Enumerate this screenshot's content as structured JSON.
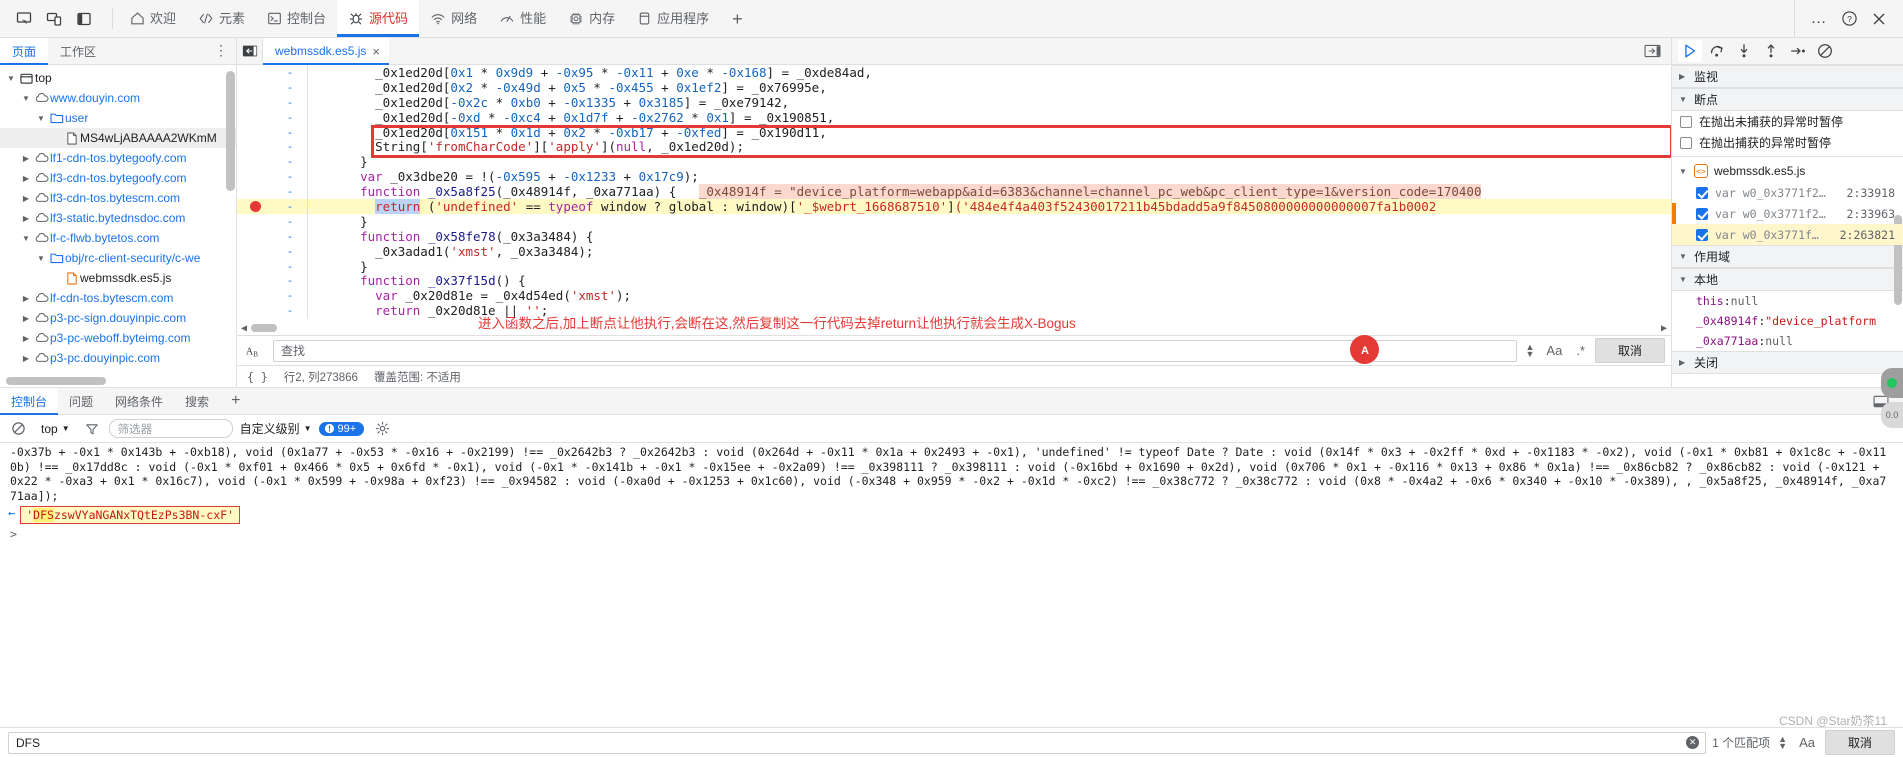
{
  "topbar": {
    "device_icons": [
      "inspect-icon",
      "device-toggle-icon",
      "dock-side-icon"
    ],
    "tabs": [
      {
        "label": "欢迎",
        "icon": "home-icon",
        "active": false
      },
      {
        "label": "元素",
        "icon": "code-brackets-icon",
        "active": false
      },
      {
        "label": "控制台",
        "icon": "terminal-icon",
        "active": false
      },
      {
        "label": "源代码",
        "icon": "bug-icon",
        "active": true
      },
      {
        "label": "网络",
        "icon": "wifi-icon",
        "active": false
      },
      {
        "label": "性能",
        "icon": "gauge-icon",
        "active": false
      },
      {
        "label": "内存",
        "icon": "chip-icon",
        "active": false
      },
      {
        "label": "应用程序",
        "icon": "database-icon",
        "active": false
      }
    ],
    "add_label": "+",
    "more_label": "…",
    "help_label": "?",
    "close_label": "×"
  },
  "navigator": {
    "tabs": [
      {
        "label": "页面",
        "active": true
      },
      {
        "label": "工作区",
        "active": false
      }
    ],
    "more_label": "⋮",
    "tree": [
      {
        "label": "top",
        "depth": 0,
        "icon": "frame-icon",
        "twisty": "down",
        "color": "dark"
      },
      {
        "label": "www.douyin.com",
        "depth": 1,
        "icon": "cloud-icon",
        "twisty": "down",
        "color": "link"
      },
      {
        "label": "user",
        "depth": 2,
        "icon": "folder-icon",
        "twisty": "down",
        "color": "link"
      },
      {
        "label": "MS4wLjABAAAA2WKmM",
        "depth": 3,
        "icon": "file-icon",
        "twisty": "none",
        "color": "dark",
        "selected": true
      },
      {
        "label": "lf1-cdn-tos.bytegoofy.com",
        "depth": 1,
        "icon": "cloud-icon",
        "twisty": "right",
        "color": "link"
      },
      {
        "label": "lf3-cdn-tos.bytegoofy.com",
        "depth": 1,
        "icon": "cloud-icon",
        "twisty": "right",
        "color": "link"
      },
      {
        "label": "lf3-cdn-tos.bytescm.com",
        "depth": 1,
        "icon": "cloud-icon",
        "twisty": "right",
        "color": "link"
      },
      {
        "label": "lf3-static.bytednsdoc.com",
        "depth": 1,
        "icon": "cloud-icon",
        "twisty": "right",
        "color": "link"
      },
      {
        "label": "lf-c-flwb.bytetos.com",
        "depth": 1,
        "icon": "cloud-icon",
        "twisty": "down",
        "color": "link"
      },
      {
        "label": "obj/rc-client-security/c-we",
        "depth": 2,
        "icon": "folder-icon",
        "twisty": "down",
        "color": "link"
      },
      {
        "label": "webmssdk.es5.js",
        "depth": 3,
        "icon": "js-file-icon",
        "twisty": "none",
        "color": "dark"
      },
      {
        "label": "lf-cdn-tos.bytescm.com",
        "depth": 1,
        "icon": "cloud-icon",
        "twisty": "right",
        "color": "link"
      },
      {
        "label": "p3-pc-sign.douyinpic.com",
        "depth": 1,
        "icon": "cloud-icon",
        "twisty": "right",
        "color": "link"
      },
      {
        "label": "p3-pc-weboff.byteimg.com",
        "depth": 1,
        "icon": "cloud-icon",
        "twisty": "right",
        "color": "link"
      },
      {
        "label": "p3-pc.douyinpic.com",
        "depth": 1,
        "icon": "cloud-icon",
        "twisty": "right",
        "color": "link"
      }
    ]
  },
  "editor": {
    "tab_label": "webmssdk.es5.js",
    "tab_close": "×",
    "lines": [
      {
        "num": "-",
        "indent": 6,
        "segments": [
          {
            "t": "_0x1ed20d",
            "c": "plain"
          },
          {
            "t": "[",
            "c": "op"
          },
          {
            "t": "0x1",
            "c": "num"
          },
          {
            "t": " * ",
            "c": "op"
          },
          {
            "t": "0x9d9",
            "c": "num"
          },
          {
            "t": " + ",
            "c": "op"
          },
          {
            "t": "-0x95",
            "c": "num"
          },
          {
            "t": " * ",
            "c": "op"
          },
          {
            "t": "-0x11",
            "c": "num"
          },
          {
            "t": " + ",
            "c": "op"
          },
          {
            "t": "0xe",
            "c": "num"
          },
          {
            "t": " * ",
            "c": "op"
          },
          {
            "t": "-0x168",
            "c": "num"
          },
          {
            "t": "] = ",
            "c": "op"
          },
          {
            "t": "_0xde84ad",
            "c": "plain"
          },
          {
            "t": ",",
            "c": "op"
          }
        ]
      },
      {
        "num": "-",
        "indent": 6,
        "segments": [
          {
            "t": "_0x1ed20d",
            "c": "plain"
          },
          {
            "t": "[",
            "c": "op"
          },
          {
            "t": "0x2",
            "c": "num"
          },
          {
            "t": " * ",
            "c": "op"
          },
          {
            "t": "-0x49d",
            "c": "num"
          },
          {
            "t": " + ",
            "c": "op"
          },
          {
            "t": "0x5",
            "c": "num"
          },
          {
            "t": " * ",
            "c": "op"
          },
          {
            "t": "-0x455",
            "c": "num"
          },
          {
            "t": " + ",
            "c": "op"
          },
          {
            "t": "0x1ef2",
            "c": "num"
          },
          {
            "t": "] = ",
            "c": "op"
          },
          {
            "t": "_0x76995e",
            "c": "plain"
          },
          {
            "t": ",",
            "c": "op"
          }
        ]
      },
      {
        "num": "-",
        "indent": 6,
        "segments": [
          {
            "t": "_0x1ed20d",
            "c": "plain"
          },
          {
            "t": "[",
            "c": "op"
          },
          {
            "t": "-0x2c",
            "c": "num"
          },
          {
            "t": " * ",
            "c": "op"
          },
          {
            "t": "0xb0",
            "c": "num"
          },
          {
            "t": " + ",
            "c": "op"
          },
          {
            "t": "-0x1335",
            "c": "num"
          },
          {
            "t": " + ",
            "c": "op"
          },
          {
            "t": "0x3185",
            "c": "num"
          },
          {
            "t": "] = ",
            "c": "op"
          },
          {
            "t": "_0xe79142",
            "c": "plain"
          },
          {
            "t": ",",
            "c": "op"
          }
        ]
      },
      {
        "num": "-",
        "indent": 6,
        "segments": [
          {
            "t": "_0x1ed20d",
            "c": "plain"
          },
          {
            "t": "[",
            "c": "op"
          },
          {
            "t": "-0xd",
            "c": "num"
          },
          {
            "t": " * ",
            "c": "op"
          },
          {
            "t": "-0xc4",
            "c": "num"
          },
          {
            "t": " + ",
            "c": "op"
          },
          {
            "t": "0x1d7f",
            "c": "num"
          },
          {
            "t": " + ",
            "c": "op"
          },
          {
            "t": "-0x2762",
            "c": "num"
          },
          {
            "t": " * ",
            "c": "op"
          },
          {
            "t": "0x1",
            "c": "num"
          },
          {
            "t": "] = ",
            "c": "op"
          },
          {
            "t": "_0x190851",
            "c": "plain"
          },
          {
            "t": ",",
            "c": "op"
          }
        ]
      },
      {
        "num": "-",
        "indent": 6,
        "segments": [
          {
            "t": "_0x1ed20d",
            "c": "plain"
          },
          {
            "t": "[",
            "c": "op"
          },
          {
            "t": "0x151",
            "c": "num"
          },
          {
            "t": " * ",
            "c": "op"
          },
          {
            "t": "0x1d",
            "c": "num"
          },
          {
            "t": " + ",
            "c": "op"
          },
          {
            "t": "0x2",
            "c": "num"
          },
          {
            "t": " * ",
            "c": "op"
          },
          {
            "t": "-0xb17",
            "c": "num"
          },
          {
            "t": " + ",
            "c": "op"
          },
          {
            "t": "-0xfed",
            "c": "num"
          },
          {
            "t": "] = ",
            "c": "op"
          },
          {
            "t": "_0x190d11",
            "c": "plain"
          },
          {
            "t": ",",
            "c": "op"
          }
        ]
      },
      {
        "num": "-",
        "indent": 6,
        "segments": [
          {
            "t": "String",
            "c": "plain"
          },
          {
            "t": "[",
            "c": "op"
          },
          {
            "t": "'fromCharCode'",
            "c": "str"
          },
          {
            "t": "][",
            "c": "op"
          },
          {
            "t": "'apply'",
            "c": "str"
          },
          {
            "t": "](",
            "c": "op"
          },
          {
            "t": "null",
            "c": "kw"
          },
          {
            "t": ", ",
            "c": "op"
          },
          {
            "t": "_0x1ed20d",
            "c": "plain"
          },
          {
            "t": ");",
            "c": "op"
          }
        ]
      },
      {
        "num": "-",
        "indent": 4,
        "segments": [
          {
            "t": "}",
            "c": "op"
          }
        ]
      },
      {
        "num": "-",
        "indent": 4,
        "segments": [
          {
            "t": "var",
            "c": "kw"
          },
          {
            "t": " _0x3dbe20 = !(",
            "c": "plain"
          },
          {
            "t": "-0x595",
            "c": "num"
          },
          {
            "t": " + ",
            "c": "op"
          },
          {
            "t": "-0x1233",
            "c": "num"
          },
          {
            "t": " + ",
            "c": "op"
          },
          {
            "t": "0x17c9",
            "c": "num"
          },
          {
            "t": ");",
            "c": "op"
          }
        ]
      },
      {
        "num": "-",
        "indent": 4,
        "segments": [
          {
            "t": "function",
            "c": "kw"
          },
          {
            "t": " ",
            "c": "op"
          },
          {
            "t": "_0x5a8f25",
            "c": "fn"
          },
          {
            "t": "(",
            "c": "op"
          },
          {
            "t": "_0x48914f",
            "c": "plain"
          },
          {
            "t": ", ",
            "c": "op"
          },
          {
            "t": "_0xa771aa",
            "c": "plain"
          },
          {
            "t": ") {",
            "c": "op"
          }
        ],
        "hint": "_0x48914f = \"device_platform=webapp&aid=6383&channel=channel_pc_web&pc_client_type=1&version_code=170400"
      },
      {
        "num": "-",
        "indent": 6,
        "breakpoint": true,
        "highlight": true,
        "segments": [
          {
            "t": "return",
            "c": "kw2sel"
          },
          {
            "t": " (",
            "c": "op"
          },
          {
            "t": "'undefined'",
            "c": "str"
          },
          {
            "t": " == ",
            "c": "op"
          },
          {
            "t": "typeof",
            "c": "kw"
          },
          {
            "t": " window ? global : window)[",
            "c": "plain"
          },
          {
            "t": "'_$webrt_1668687510'",
            "c": "str"
          },
          {
            "t": "]",
            "c": "op"
          }
        ],
        "tail": "('484e4f4a403f52430017211b45bdadd5a9f8450800000000000007fa1b0002"
      },
      {
        "num": "-",
        "indent": 4,
        "segments": [
          {
            "t": "}",
            "c": "op"
          }
        ]
      },
      {
        "num": "-",
        "indent": 4,
        "segments": [
          {
            "t": "function",
            "c": "kw"
          },
          {
            "t": " ",
            "c": "op"
          },
          {
            "t": "_0x58fe78",
            "c": "fn"
          },
          {
            "t": "(",
            "c": "op"
          },
          {
            "t": "_0x3a3484",
            "c": "plain"
          },
          {
            "t": ") {",
            "c": "op"
          }
        ]
      },
      {
        "num": "-",
        "indent": 6,
        "segments": [
          {
            "t": "_0x3adad1",
            "c": "plain"
          },
          {
            "t": "(",
            "c": "op"
          },
          {
            "t": "'xmst'",
            "c": "str"
          },
          {
            "t": ", ",
            "c": "op"
          },
          {
            "t": "_0x3a3484",
            "c": "plain"
          },
          {
            "t": ");",
            "c": "op"
          }
        ]
      },
      {
        "num": "-",
        "indent": 4,
        "segments": [
          {
            "t": "}",
            "c": "op"
          }
        ]
      },
      {
        "num": "-",
        "indent": 4,
        "segments": [
          {
            "t": "function",
            "c": "kw"
          },
          {
            "t": " ",
            "c": "op"
          },
          {
            "t": "_0x37f15d",
            "c": "fn"
          },
          {
            "t": "() {",
            "c": "op"
          }
        ]
      },
      {
        "num": "-",
        "indent": 6,
        "segments": [
          {
            "t": "var",
            "c": "kw"
          },
          {
            "t": " _0x20d81e = ",
            "c": "plain"
          },
          {
            "t": "_0x4d54ed",
            "c": "plain"
          },
          {
            "t": "(",
            "c": "op"
          },
          {
            "t": "'xmst'",
            "c": "str"
          },
          {
            "t": ");",
            "c": "op"
          }
        ]
      },
      {
        "num": "-",
        "indent": 6,
        "segments": [
          {
            "t": "return",
            "c": "kw"
          },
          {
            "t": " _0x20d81e || ",
            "c": "plain"
          },
          {
            "t": "''",
            "c": "str"
          },
          {
            "t": ";",
            "c": "op"
          }
        ]
      }
    ],
    "annotation": "进入函数之后,加上断点让他执行,会断在这,然后复制这一行代码去掉return让他执行就会生成X-Bogus",
    "find": {
      "placeholder": "查找",
      "value": "",
      "match_case_label": "Aa",
      "regex_label": ".*",
      "cancel_label": "取消"
    },
    "status": {
      "position": "行2, 列273866",
      "coverage": "覆盖范围: 不适用",
      "format_label": "{ }"
    }
  },
  "debugger": {
    "toolbar_icons": [
      {
        "name": "resume-script-icon",
        "active": true
      },
      {
        "name": "step-over-icon",
        "active": false
      },
      {
        "name": "step-into-icon",
        "active": false
      },
      {
        "name": "step-out-icon",
        "active": false
      },
      {
        "name": "step-icon",
        "active": false
      },
      {
        "name": "deactivate-breakpoints-icon",
        "active": false
      }
    ],
    "sections": {
      "watch": {
        "label": "监视",
        "expanded": false
      },
      "breakpoints": {
        "label": "断点",
        "expanded": true
      },
      "scope": {
        "label": "作用域",
        "expanded": true
      },
      "local": {
        "label": "本地",
        "expanded": true
      },
      "closure": {
        "label": "关闭",
        "expanded": false
      }
    },
    "pause_options": [
      {
        "label": "在抛出未捕获的异常时暂停",
        "checked": false
      },
      {
        "label": "在抛出捕获的异常时暂停",
        "checked": false
      }
    ],
    "breakpoint_file": "webmssdk.es5.js",
    "breakpoint_items": [
      {
        "checked": true,
        "name": "var w0_0x3771f2…",
        "location": "2:33918",
        "selected": false,
        "marked": false
      },
      {
        "checked": true,
        "name": "var w0_0x3771f2…",
        "location": "2:33963",
        "selected": false,
        "marked": true
      },
      {
        "checked": true,
        "name": "var w0_0x3771f…",
        "location": "2:263821",
        "selected": true,
        "marked": false
      }
    ],
    "scope_items": [
      {
        "key": "this",
        "value": "null",
        "type": "null"
      },
      {
        "key": "_0x48914f",
        "value": "\"device_platform",
        "type": "string"
      },
      {
        "key": "_0xa771aa",
        "value": "null",
        "type": "null"
      }
    ]
  },
  "drawer": {
    "tabs": [
      {
        "label": "控制台",
        "active": true
      },
      {
        "label": "问题",
        "active": false
      },
      {
        "label": "网络条件",
        "active": false
      },
      {
        "label": "搜索",
        "active": false
      }
    ],
    "add_label": "+",
    "toolbar": {
      "clear_icon": "no-entry-icon",
      "context": "top",
      "filter_placeholder": "筛选器",
      "filter_value": "",
      "level": "自定义级别",
      "issue_count": "99+",
      "settings_icon": "gear-icon"
    },
    "console_output": "-0x37b + -0x1 * 0x143b + -0xb18), void (0x1a77 + -0x53 * -0x16 + -0x2199) !== _0x2642b3 ? _0x2642b3 : void (0x264d + -0x11 * 0x1a + 0x2493 + -0x1), 'undefined' != typeof Date ? Date : void (0x14f * 0x3 + -0x2ff * 0xd + -0x1183 * -0x2), void (-0x1 * 0xb81 + 0x1c8c + -0x110b) !== _0x17dd8c : void (-0x1 * 0xf01 + 0x466 * 0x5 + 0x6fd * -0x1), void (-0x1 * -0x141b + -0x1 * -0x15ee + -0x2a09) !== _0x398111 ? _0x398111 : void (-0x16bd + 0x1690 + 0x2d), void (0x706 * 0x1 + -0x116 * 0x13 + 0x86 * 0x1a) !== _0x86cb82 ? _0x86cb82 : void (-0x121 + 0x22 * -0xa3 + 0x1 * 0x16c7), void (-0x1 * 0x599 + -0x98a + 0xf23) !== _0x94582 : void (-0xa0d + -0x1253 + 0x1c60), void (-0x348 + 0x959 * -0x2 + -0x1d * -0xc2) !== _0x38c772 ? _0x38c772 : void (0x8 * -0x4a2 + -0x6 * 0x340 + -0x10 * -0x389), , _0x5a8f25, _0x48914f, _0xa771aa]);",
    "result": {
      "prefix": "DFS",
      "rest": "zswVYaNGANxTQtEzPs3BN-cxF",
      "quote": "'"
    },
    "prompt": ">"
  },
  "searchbar": {
    "value": "DFS",
    "placeholder": "",
    "match_count": "1 个匹配项",
    "match_case_label": "Aa",
    "cancel_label": "取消"
  },
  "watermark": "CSDN @Star奶茶11",
  "colors": {
    "accent": "#1a73e8",
    "active_tab": "#d93025",
    "breakpoint": "#e53935",
    "highlight": "#fff9c4",
    "hint": "#fcd9ce"
  }
}
